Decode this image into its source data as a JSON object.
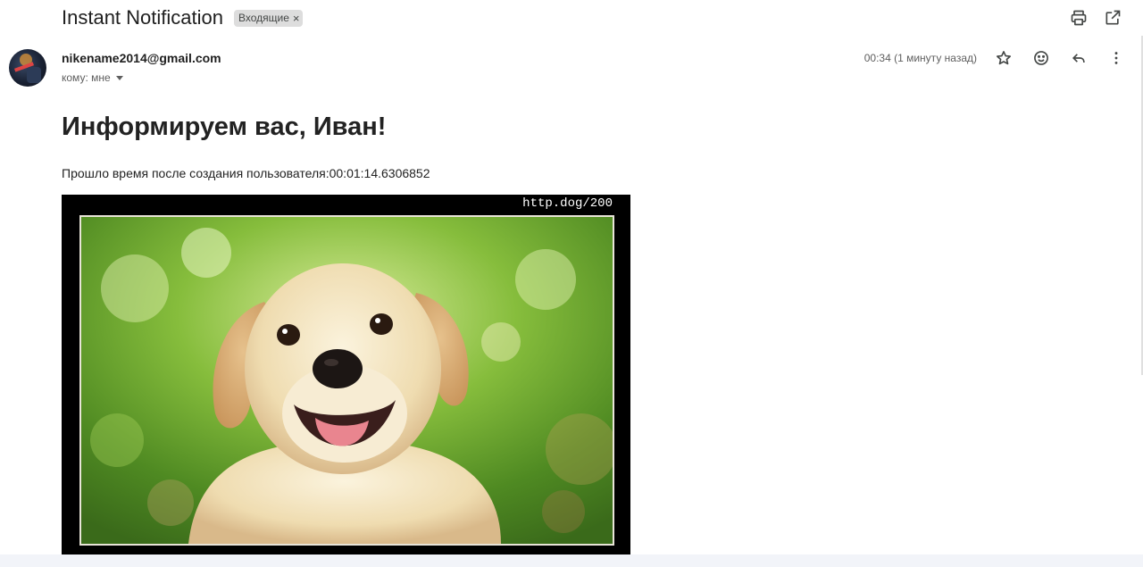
{
  "email": {
    "subject": "Instant Notification",
    "label": "Входящие",
    "label_remove": "×",
    "sender": "nikename2014@gmail.com",
    "to_line": "кому: мне",
    "time": "00:34 (1 минуту назад)",
    "heading": "Информируем вас, Иван!",
    "body": "Прошло время после создания пользователя:00:01:14.6306852",
    "image_caption": "http.dog/200"
  },
  "icons": {
    "top": [
      "print-icon",
      "open-in-new-window-icon"
    ],
    "meta": [
      "star-icon",
      "emoji-icon",
      "reply-icon",
      "more-vertical-icon"
    ]
  },
  "colors": {
    "chip_bg": "#dddddd",
    "image_frame": "#000000",
    "bottom_strip": "#f2f4f9"
  }
}
